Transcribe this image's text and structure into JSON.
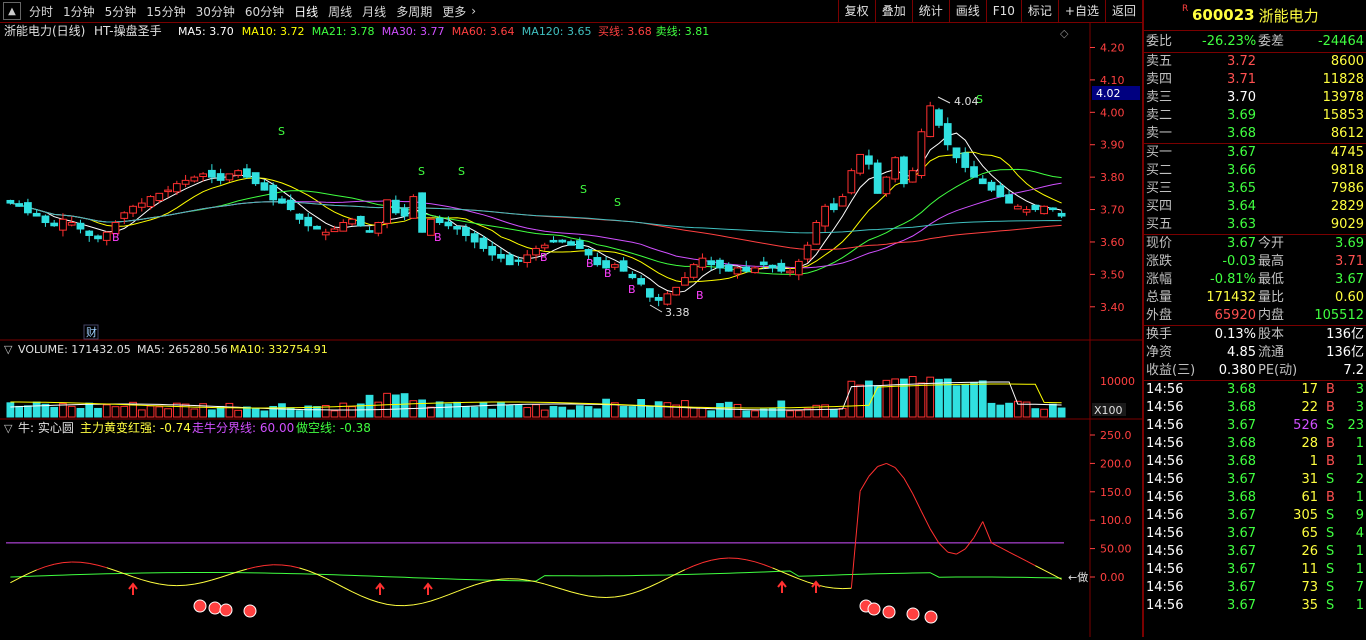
{
  "toolbar": {
    "periods": [
      "分时",
      "1分钟",
      "5分钟",
      "15分钟",
      "30分钟",
      "60分钟",
      "日线",
      "周线",
      "月线",
      "多周期",
      "更多"
    ],
    "active_period": "日线",
    "right_buttons": [
      "复权",
      "叠加",
      "统计",
      "画线",
      "F10",
      "标记",
      "+自选",
      "返回"
    ]
  },
  "main_chart": {
    "legend": {
      "title": "浙能电力(日线)",
      "indicator": "HT-操盘圣手",
      "items": [
        {
          "label": "MA5: 3.70",
          "color": "#ffffff"
        },
        {
          "label": "MA10: 3.72",
          "color": "#ffff00"
        },
        {
          "label": "MA21: 3.78",
          "color": "#40ff40"
        },
        {
          "label": "MA30: 3.77",
          "color": "#d050ff"
        },
        {
          "label": "MA60: 3.64",
          "color": "#ff4040"
        },
        {
          "label": "MA120: 3.65",
          "color": "#40c0c0"
        },
        {
          "label": "买线: 3.68",
          "color": "#ff4040"
        },
        {
          "label": "卖线: 3.81",
          "color": "#40ff40"
        }
      ]
    },
    "y_ticks": [
      "4.20",
      "4.10",
      "4.00",
      "3.90",
      "3.80",
      "3.70",
      "3.60",
      "3.50",
      "3.40"
    ],
    "current_price_tag": "4.02",
    "high_label": "4.04",
    "low_label": "3.38",
    "cai_label": "财",
    "s_marks": [
      "S",
      "S",
      "S",
      "S",
      "S",
      "S"
    ],
    "b_marks": [
      "B",
      "B",
      "B",
      "B",
      "B",
      "B",
      "B"
    ]
  },
  "volume_chart": {
    "legend": {
      "title": "VOLUME: 171432.05",
      "ma5": "MA5: 265280.56",
      "ma10": "MA10: 332754.91"
    },
    "y_tick": "10000",
    "unit": "X100"
  },
  "indicator_chart": {
    "legend": {
      "name": "牛: 实心圆",
      "l1": "主力黄变红强: -0.74",
      "l2": "走牛分界线: 60.00",
      "l3": "做空线: -0.38"
    },
    "y_ticks": [
      "250.0",
      "200.0",
      "150.0",
      "100.0",
      "50.00",
      "0.00"
    ],
    "end_label": "←做"
  },
  "quote": {
    "r_mark": "R",
    "code": "600023",
    "name": "浙能电力",
    "weibi_label": "委比",
    "weibi": "-26.23%",
    "weicha_label": "委差",
    "weicha": "-24464",
    "sells": [
      {
        "label": "卖五",
        "price": "3.72",
        "vol": "8600",
        "color": "up"
      },
      {
        "label": "卖四",
        "price": "3.71",
        "vol": "11828",
        "color": "up"
      },
      {
        "label": "卖三",
        "price": "3.70",
        "vol": "13978",
        "color": "white"
      },
      {
        "label": "卖二",
        "price": "3.69",
        "vol": "15853",
        "color": "down"
      },
      {
        "label": "卖一",
        "price": "3.68",
        "vol": "8612",
        "color": "down"
      }
    ],
    "buys": [
      {
        "label": "买一",
        "price": "3.67",
        "vol": "4745",
        "color": "down"
      },
      {
        "label": "买二",
        "price": "3.66",
        "vol": "9818",
        "color": "down"
      },
      {
        "label": "买三",
        "price": "3.65",
        "vol": "7986",
        "color": "down"
      },
      {
        "label": "买四",
        "price": "3.64",
        "vol": "2829",
        "color": "down"
      },
      {
        "label": "买五",
        "price": "3.63",
        "vol": "9029",
        "color": "down"
      }
    ],
    "stats": [
      {
        "l1": "现价",
        "v1": "3.67",
        "c1": "down",
        "l2": "今开",
        "v2": "3.69",
        "c2": "down"
      },
      {
        "l1": "涨跌",
        "v1": "-0.03",
        "c1": "down",
        "l2": "最高",
        "v2": "3.71",
        "c2": "up"
      },
      {
        "l1": "涨幅",
        "v1": "-0.81%",
        "c1": "down",
        "l2": "最低",
        "v2": "3.67",
        "c2": "down"
      },
      {
        "l1": "总量",
        "v1": "171432",
        "c1": "yellow",
        "l2": "量比",
        "v2": "0.60",
        "c2": "yellow"
      },
      {
        "l1": "外盘",
        "v1": "65920",
        "c1": "up",
        "l2": "内盘",
        "v2": "105512",
        "c2": "down"
      }
    ],
    "extra": [
      {
        "l1": "换手",
        "v1": "0.13%",
        "l2": "股本",
        "v2": "136亿"
      },
      {
        "l1": "净资",
        "v1": "4.85",
        "l2": "流通",
        "v2": "136亿"
      },
      {
        "l1": "收益(三)",
        "v1": "0.380",
        "l2": "PE(动)",
        "v2": "7.2"
      }
    ],
    "ticks": [
      {
        "time": "14:56",
        "price": "3.68",
        "pc": "down",
        "vol": "17",
        "vc": "yellow",
        "bs": "B",
        "bsc": "up",
        "n": "3"
      },
      {
        "time": "14:56",
        "price": "3.68",
        "pc": "down",
        "vol": "22",
        "vc": "yellow",
        "bs": "B",
        "bsc": "up",
        "n": "3"
      },
      {
        "time": "14:56",
        "price": "3.67",
        "pc": "down",
        "vol": "526",
        "vc": "purple",
        "bs": "S",
        "bsc": "down",
        "n": "23"
      },
      {
        "time": "14:56",
        "price": "3.68",
        "pc": "down",
        "vol": "28",
        "vc": "yellow",
        "bs": "B",
        "bsc": "up",
        "n": "1"
      },
      {
        "time": "14:56",
        "price": "3.68",
        "pc": "down",
        "vol": "1",
        "vc": "yellow",
        "bs": "B",
        "bsc": "up",
        "n": "1"
      },
      {
        "time": "14:56",
        "price": "3.67",
        "pc": "down",
        "vol": "31",
        "vc": "yellow",
        "bs": "S",
        "bsc": "down",
        "n": "2"
      },
      {
        "time": "14:56",
        "price": "3.68",
        "pc": "down",
        "vol": "61",
        "vc": "yellow",
        "bs": "B",
        "bsc": "up",
        "n": "1"
      },
      {
        "time": "14:56",
        "price": "3.67",
        "pc": "down",
        "vol": "305",
        "vc": "yellow",
        "bs": "S",
        "bsc": "down",
        "n": "9"
      },
      {
        "time": "14:56",
        "price": "3.67",
        "pc": "down",
        "vol": "65",
        "vc": "yellow",
        "bs": "S",
        "bsc": "down",
        "n": "4"
      },
      {
        "time": "14:56",
        "price": "3.67",
        "pc": "down",
        "vol": "26",
        "vc": "yellow",
        "bs": "S",
        "bsc": "down",
        "n": "1"
      },
      {
        "time": "14:56",
        "price": "3.67",
        "pc": "down",
        "vol": "11",
        "vc": "yellow",
        "bs": "S",
        "bsc": "down",
        "n": "1"
      },
      {
        "time": "14:56",
        "price": "3.67",
        "pc": "down",
        "vol": "73",
        "vc": "yellow",
        "bs": "S",
        "bsc": "down",
        "n": "7"
      },
      {
        "time": "14:56",
        "price": "3.67",
        "pc": "down",
        "vol": "35",
        "vc": "yellow",
        "bs": "S",
        "bsc": "down",
        "n": "1"
      }
    ]
  },
  "chart_data": {
    "type": "candlestick",
    "ylim": [
      3.35,
      4.22
    ],
    "closes": [
      3.72,
      3.71,
      3.69,
      3.68,
      3.66,
      3.65,
      3.67,
      3.66,
      3.64,
      3.62,
      3.61,
      3.63,
      3.66,
      3.69,
      3.71,
      3.72,
      3.74,
      3.75,
      3.76,
      3.78,
      3.79,
      3.8,
      3.81,
      3.8,
      3.79,
      3.81,
      3.82,
      3.8,
      3.78,
      3.76,
      3.73,
      3.72,
      3.7,
      3.67,
      3.65,
      3.64,
      3.63,
      3.64,
      3.66,
      3.67,
      3.65,
      3.63,
      3.66,
      3.73,
      3.69,
      3.68,
      3.74,
      3.63,
      3.67,
      3.66,
      3.65,
      3.64,
      3.62,
      3.6,
      3.58,
      3.56,
      3.55,
      3.53,
      3.54,
      3.56,
      3.58,
      3.59,
      3.6,
      3.6,
      3.59,
      3.58,
      3.56,
      3.53,
      3.52,
      3.53,
      3.51,
      3.49,
      3.47,
      3.43,
      3.42,
      3.44,
      3.46,
      3.49,
      3.53,
      3.55,
      3.53,
      3.52,
      3.51,
      3.52,
      3.51,
      3.52,
      3.53,
      3.52,
      3.51,
      3.51,
      3.54,
      3.59,
      3.66,
      3.71,
      3.7,
      3.74,
      3.82,
      3.87,
      3.84,
      3.75,
      3.8,
      3.86,
      3.78,
      3.82,
      3.94,
      4.02,
      3.96,
      3.9,
      3.86,
      3.83,
      3.8,
      3.78,
      3.76,
      3.74,
      3.72,
      3.71,
      3.7,
      3.7,
      3.71,
      3.7,
      3.68
    ]
  }
}
